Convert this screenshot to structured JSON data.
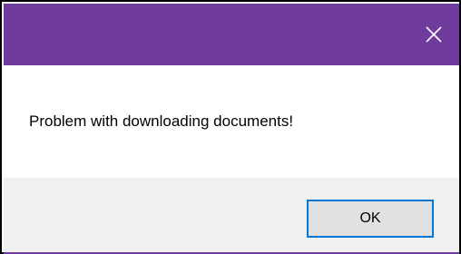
{
  "dialog": {
    "title": "",
    "message": "Problem with downloading documents!",
    "ok_label": "OK",
    "close_icon": "close-icon"
  },
  "colors": {
    "title_bar": "#6f3c9e",
    "footer": "#f0f0f0",
    "button_face": "#e1e1e1",
    "button_border": "#0078d7"
  }
}
